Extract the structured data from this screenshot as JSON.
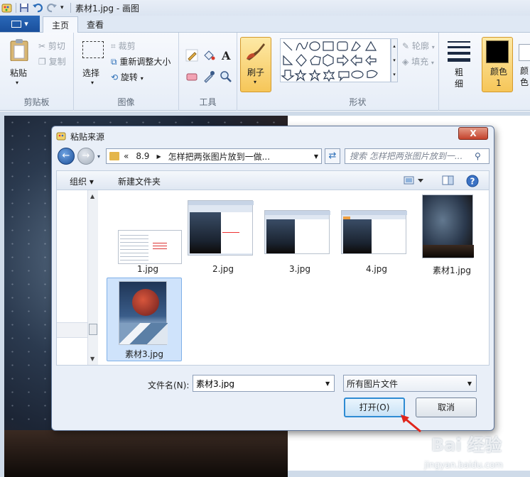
{
  "window": {
    "title": "素材1.jpg - 画图",
    "file_tab_glyph": "▾",
    "tabs": [
      {
        "label": "主页",
        "active": true
      },
      {
        "label": "查看",
        "active": false
      }
    ]
  },
  "ribbon": {
    "clipboard": {
      "paste": "粘贴",
      "cut": "剪切",
      "copy": "复制",
      "group_label": "剪贴板"
    },
    "image": {
      "select": "选择",
      "crop": "裁剪",
      "resize": "重新调整大小",
      "rotate": "旋转",
      "group_label": "图像"
    },
    "tools": {
      "group_label": "工具"
    },
    "brushes": {
      "label": "刷子"
    },
    "shapes": {
      "outline": "轮廓",
      "fill": "填充",
      "group_label": "形状"
    },
    "size": {
      "label": "粗细"
    },
    "color1": {
      "label": "颜色 1"
    },
    "color2": {
      "label": "颜色"
    }
  },
  "dialog": {
    "title": "粘贴来源",
    "close": "X",
    "breadcrumb": [
      "«",
      "8.9",
      "怎样把两张图片放到一做..."
    ],
    "search_placeholder": "搜索 怎样把两张图片放到一...",
    "toolbar": {
      "organize": "组织 ▾",
      "new_folder": "新建文件夹"
    },
    "files": [
      {
        "name": "1.jpg",
        "selected": false
      },
      {
        "name": "2.jpg",
        "selected": false
      },
      {
        "name": "3.jpg",
        "selected": false
      },
      {
        "name": "4.jpg",
        "selected": false
      },
      {
        "name": "素材1.jpg",
        "selected": false
      },
      {
        "name": "素材3.jpg",
        "selected": true
      }
    ],
    "filename_label": "文件名(N):",
    "filename_value": "素材3.jpg",
    "filetype_value": "所有图片文件",
    "open_button": "打开(O)",
    "cancel_button": "取消"
  },
  "watermark": {
    "text": "Bai 经验",
    "sub": "jingyan.baidu.com"
  },
  "colors": {
    "accent": "#1a4f9c",
    "selection": "#cfe3fb",
    "close_red": "#c4422c",
    "arrow_red": "#e0251b"
  }
}
